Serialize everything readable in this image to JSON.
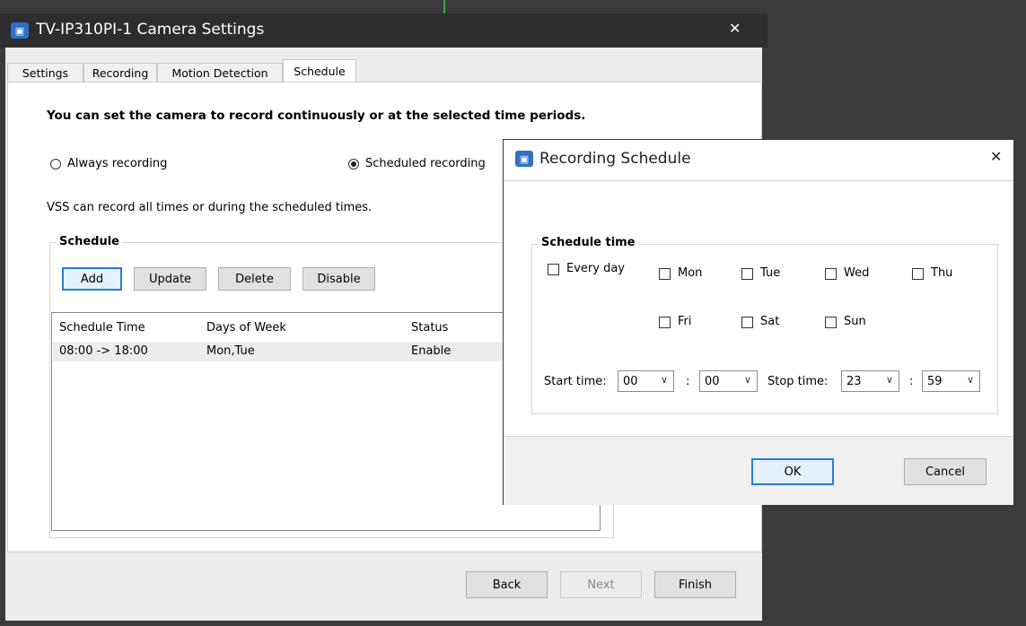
{
  "main_window": {
    "title": "TV-IP310PI-1 Camera Settings",
    "app_icon_glyph": "▣",
    "close_glyph": "✕",
    "tabs": [
      {
        "label": "Settings",
        "active": false
      },
      {
        "label": "Recording",
        "active": false
      },
      {
        "label": "Motion Detection",
        "active": false
      },
      {
        "label": "Schedule",
        "active": true
      }
    ],
    "heading": "You can set the camera to record continuously or at the selected time periods.",
    "radio_always": "Always recording",
    "radio_scheduled": "Scheduled recording",
    "selected_mode": "Scheduled recording",
    "description": "VSS can record all times or during the scheduled times.",
    "schedule_group": {
      "title": "Schedule",
      "buttons": {
        "add": "Add",
        "update": "Update",
        "delete": "Delete",
        "disable": "Disable"
      },
      "columns": [
        "Schedule Time",
        "Days of Week",
        "Status"
      ],
      "rows": [
        {
          "time": "08:00 -> 18:00",
          "days": "Mon,Tue",
          "status": "Enable"
        }
      ]
    },
    "footer_buttons": {
      "back": "Back",
      "next": "Next",
      "finish": "Finish"
    }
  },
  "dialog": {
    "title": "Recording Schedule",
    "close_glyph": "✕",
    "group_title": "Schedule time",
    "every_day": "Every day",
    "days": {
      "mon": "Mon",
      "tue": "Tue",
      "wed": "Wed",
      "thu": "Thu",
      "fri": "Fri",
      "sat": "Sat",
      "sun": "Sun"
    },
    "checked": [],
    "start_label": "Start time:",
    "stop_label": "Stop time:",
    "colon": ":",
    "start_hour": "00",
    "start_minute": "00",
    "stop_hour": "23",
    "stop_minute": "59",
    "chevron": "∨",
    "ok": "OK",
    "cancel": "Cancel"
  },
  "colors": {
    "accent": "#2a7bd4",
    "titlebar": "#2d2d30",
    "desktop": "#3b3b3b"
  }
}
